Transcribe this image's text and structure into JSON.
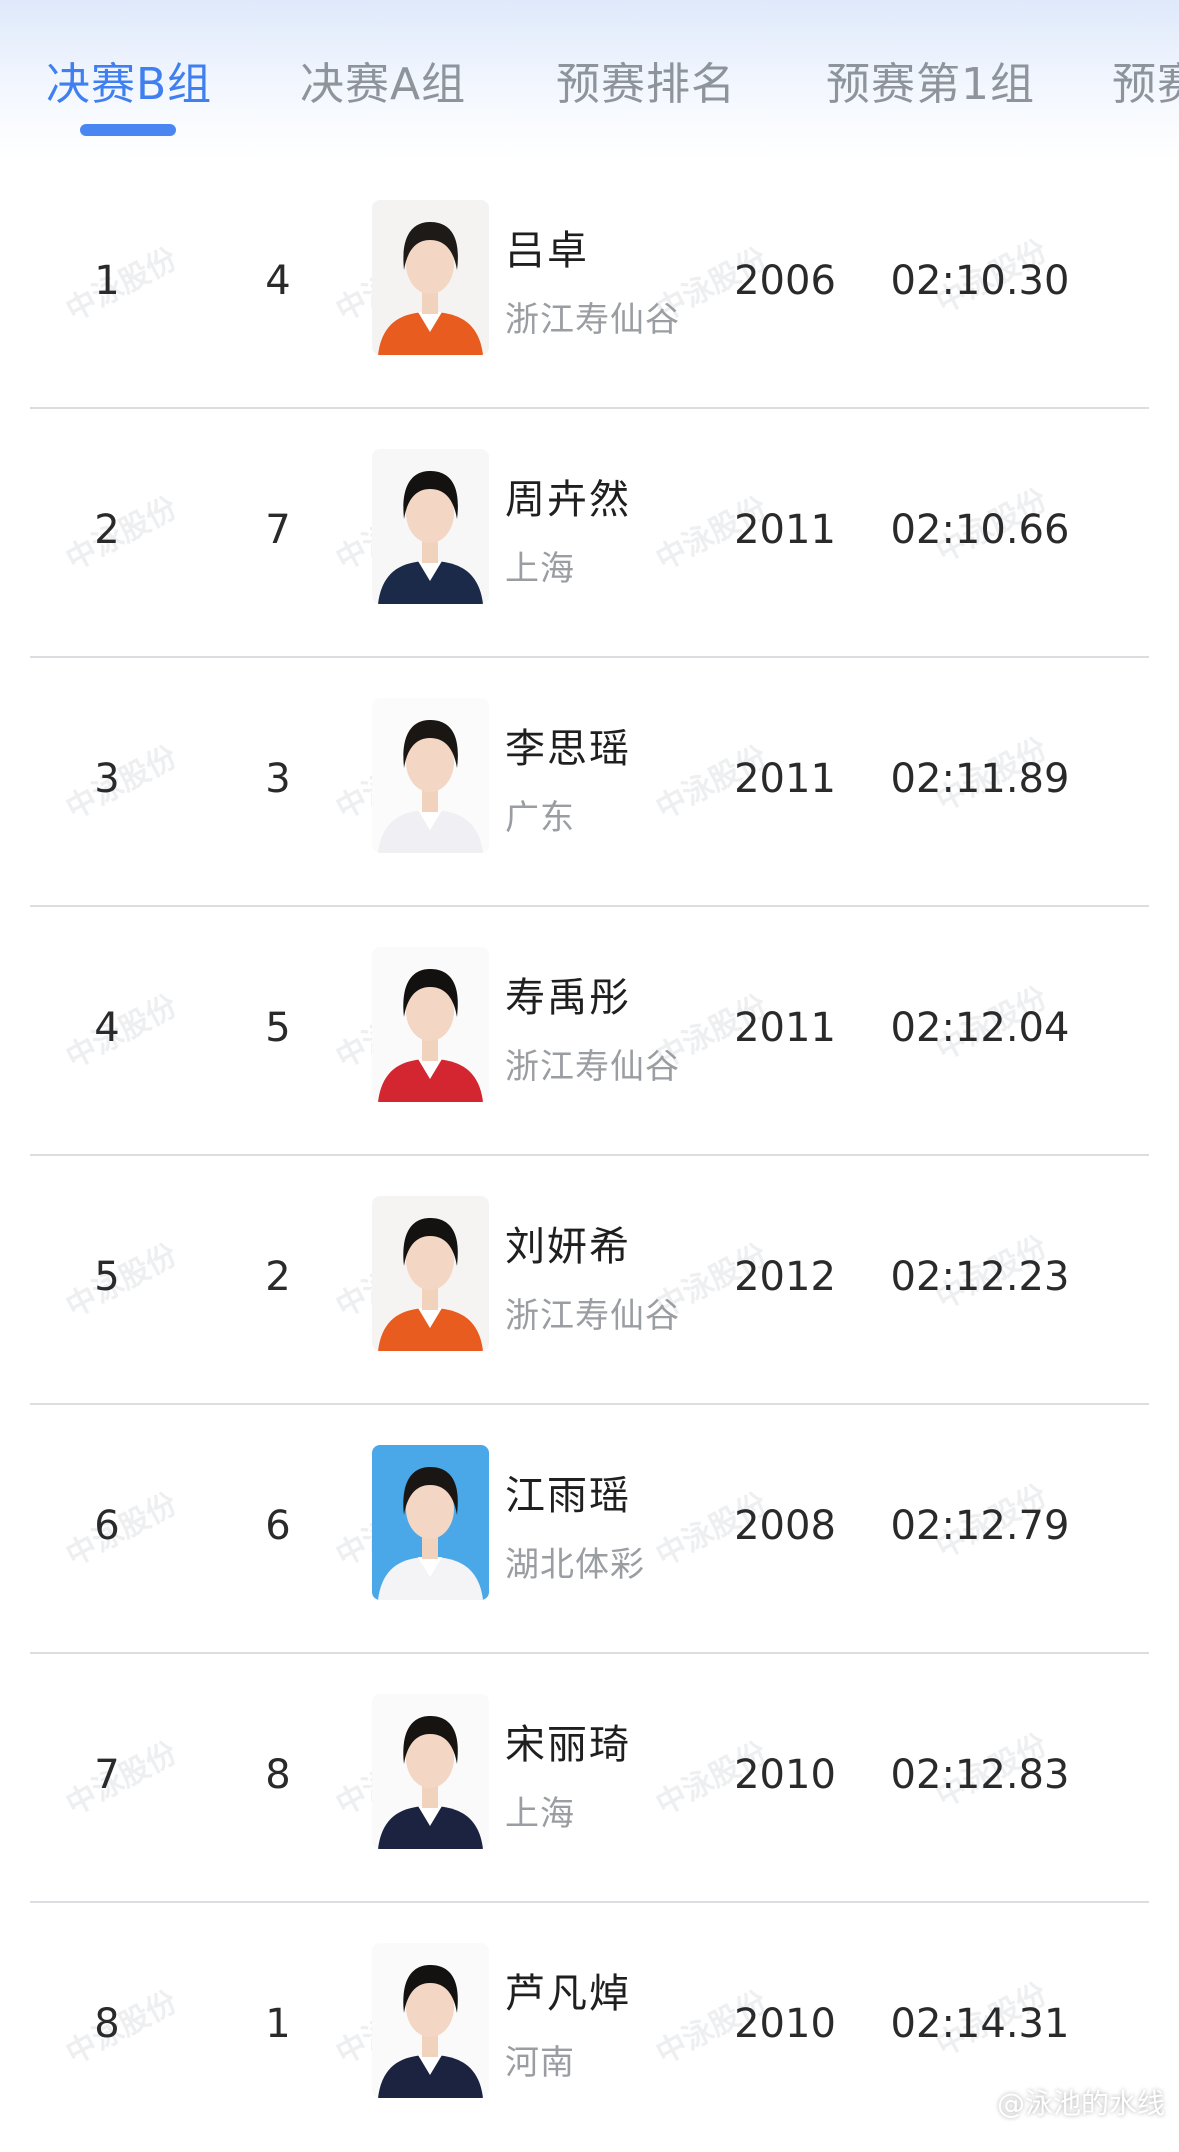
{
  "tabs": [
    {
      "label": "决赛B组",
      "active": true
    },
    {
      "label": "决赛A组",
      "active": false
    },
    {
      "label": "预赛排名",
      "active": false
    },
    {
      "label": "预赛第1组",
      "active": false
    },
    {
      "label": "预赛",
      "active": false
    }
  ],
  "colors": {
    "accent": "#3f7ff0",
    "tab_inactive": "#8e949c",
    "divider": "#dcdde0",
    "team_text": "#9a9da2"
  },
  "watermark": "中泳股份",
  "results": [
    {
      "rank": "1",
      "lane": "4",
      "name": "吕卓",
      "team": "浙江寿仙谷",
      "year": "2006",
      "time": "02:10.30",
      "photo_bg": "#f5f3f1",
      "outfit": "#e85c1f",
      "hair": "#1e1a17"
    },
    {
      "rank": "2",
      "lane": "7",
      "name": "周卉然",
      "team": "上海",
      "year": "2011",
      "time": "02:10.66",
      "photo_bg": "#f7f7f7",
      "outfit": "#1c2a4a",
      "hair": "#141210"
    },
    {
      "rank": "3",
      "lane": "3",
      "name": "李思瑶",
      "team": "广东",
      "year": "2011",
      "time": "02:11.89",
      "photo_bg": "#fbfbfb",
      "outfit": "#f0f0f4",
      "hair": "#1a1614"
    },
    {
      "rank": "4",
      "lane": "5",
      "name": "寿禹彤",
      "team": "浙江寿仙谷",
      "year": "2011",
      "time": "02:12.04",
      "photo_bg": "#fafafa",
      "outfit": "#d32630",
      "hair": "#121110"
    },
    {
      "rank": "5",
      "lane": "2",
      "name": "刘妍希",
      "team": "浙江寿仙谷",
      "year": "2012",
      "time": "02:12.23",
      "photo_bg": "#f6f4f2",
      "outfit": "#e85c1f",
      "hair": "#141210"
    },
    {
      "rank": "6",
      "lane": "6",
      "name": "江雨瑶",
      "team": "湖北体彩",
      "year": "2008",
      "time": "02:12.79",
      "photo_bg": "#4aa8e8",
      "outfit": "#f4f4f6",
      "hair": "#1a1614"
    },
    {
      "rank": "7",
      "lane": "8",
      "name": "宋丽琦",
      "team": "上海",
      "year": "2010",
      "time": "02:12.83",
      "photo_bg": "#fafafa",
      "outfit": "#1c2340",
      "hair": "#161311"
    },
    {
      "rank": "8",
      "lane": "1",
      "name": "芦凡焯",
      "team": "河南",
      "year": "2010",
      "time": "02:14.31",
      "photo_bg": "#fafafa",
      "outfit": "#1c2340",
      "hair": "#141210"
    }
  ],
  "credit": "@泳池的水线"
}
